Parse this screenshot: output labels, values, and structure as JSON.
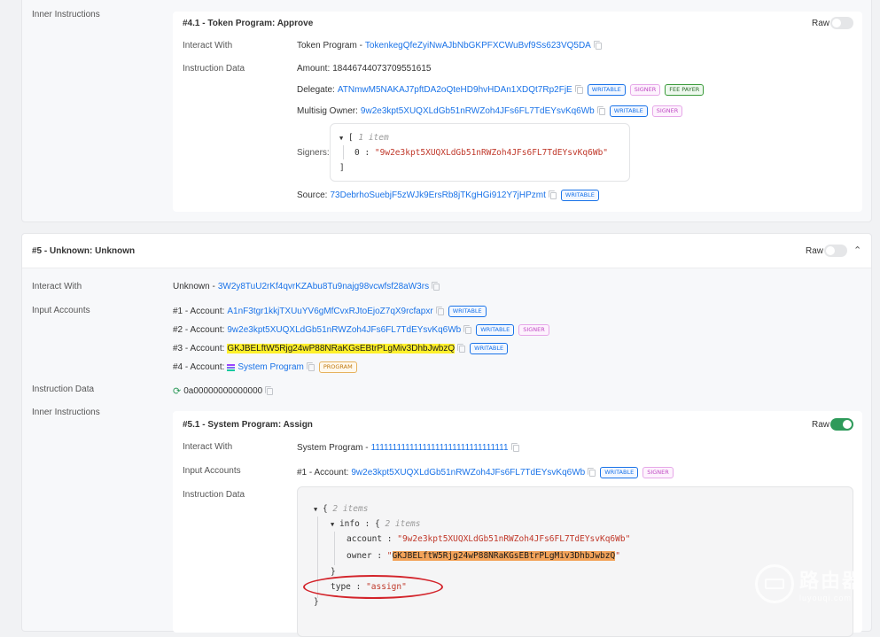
{
  "top": {
    "inner_label": "Inner Instructions",
    "card": {
      "title": "#4.1 - Token Program: Approve",
      "raw": "Raw",
      "interact_label": "Interact With",
      "interact_prefix": "Token Program - ",
      "interact_addr": "TokenkegQfeZyiNwAJbNbGKPFXCWuBvf9Ss623VQ5DA",
      "data_label": "Instruction Data",
      "amount_label": "Amount: ",
      "amount": "18446744073709551615",
      "delegate_label": "Delegate: ",
      "delegate": "ATNmwM5NAKAJ7pftDA2oQteHD9hvHDAn1XDQt7Rp2FjE",
      "multisig_label": "Multisig Owner: ",
      "multisig": "9w2e3kpt5XUQXLdGb51nRWZoh4JFs6FL7TdEYsvKq6Wb",
      "signers_label": "Signers:",
      "signers_count": "1 item",
      "signers_idx": "0",
      "signers_val": "\"9w2e3kpt5XUQXLdGb51nRWZoh4JFs6FL7TdEYsvKq6Wb\"",
      "source_label": "Source: ",
      "source": "73DebrhoSuebjF5zWJk9ErsRb8jTKgHGi912Y7jHPzmt"
    }
  },
  "badges": {
    "writable": "WRITABLE",
    "signer": "SIGNER",
    "fee_payer": "FEE PAYER",
    "program": "PROGRAM"
  },
  "ix5": {
    "title": "#5 - Unknown: Unknown",
    "raw": "Raw",
    "interact_label": "Interact With",
    "interact_prefix": "Unknown - ",
    "interact_addr": "3W2y8TuU2rKf4qvrKZAbu8Tu9najg98vcwfsf28aW3rs",
    "input_label": "Input Accounts",
    "accounts": [
      {
        "prefix": "#1 - Account: ",
        "addr": "A1nF3tgr1kkjTXUuYV6gMfCvxRJtoEjoZ7qX9rcfapxr"
      },
      {
        "prefix": "#2 - Account: ",
        "addr": "9w2e3kpt5XUQXLdGb51nRWZoh4JFs6FL7TdEYsvKq6Wb"
      },
      {
        "prefix": "#3 - Account: ",
        "addr": "GKJBELftW5Rjg24wP88NRaKGsEBtrPLgMiv3DhbJwbzQ"
      },
      {
        "prefix": "#4 - Account: ",
        "addr": "System Program"
      }
    ],
    "data_label": "Instruction Data",
    "data_value": "0a00000000000000",
    "inner_label": "Inner Instructions",
    "inner": {
      "title": "#5.1 - System Program: Assign",
      "raw": "Raw",
      "interact_label": "Interact With",
      "interact_prefix": "System Program - ",
      "interact_addr": "11111111111111111111111111111111",
      "input_label": "Input Accounts",
      "account_prefix": "#1 - Account: ",
      "account_addr": "9w2e3kpt5XUQXLdGb51nRWZoh4JFs6FL7TdEYsvKq6Wb",
      "data_label": "Instruction Data",
      "json": {
        "root_count": "2 items",
        "info_key": "info",
        "info_count": "2 items",
        "account_key": "account",
        "account_val": "\"9w2e3kpt5XUQXLdGb51nRWZoh4JFs6FL7TdEYsvKq6Wb\"",
        "owner_key": "owner",
        "owner_val": "GKJBELftW5Rjg24wP88NRaKGsEBtrPLgMiv3DhbJwbzQ",
        "type_key": "type",
        "type_val": "\"assign\""
      }
    }
  },
  "watermark": {
    "brand": "路由器",
    "domain": "luyouqi.com"
  }
}
